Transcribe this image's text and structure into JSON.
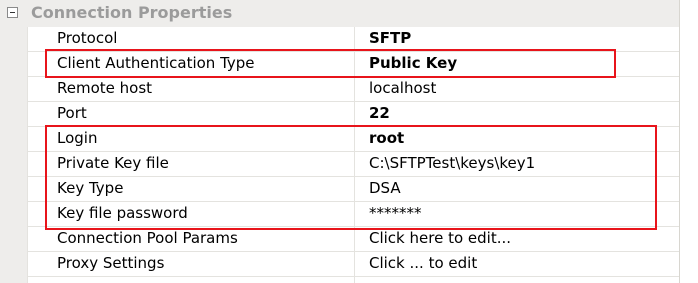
{
  "category": {
    "label": "Connection Properties"
  },
  "properties": [
    {
      "name": "Protocol",
      "value": "SFTP",
      "bold": true
    },
    {
      "name": "Client Authentication Type",
      "value": "Public Key",
      "bold": true
    },
    {
      "name": "Remote host",
      "value": "localhost",
      "bold": false
    },
    {
      "name": "Port",
      "value": "22",
      "bold": true
    },
    {
      "name": "Login",
      "value": "root",
      "bold": true
    },
    {
      "name": "Private Key file",
      "value": "C:\\SFTPTest\\keys\\key1",
      "bold": false
    },
    {
      "name": "Key Type",
      "value": "DSA",
      "bold": false
    },
    {
      "name": "Key file password",
      "value": "*******",
      "bold": false
    },
    {
      "name": "Connection Pool Params",
      "value": "Click here to edit...",
      "bold": false
    },
    {
      "name": "Proxy Settings",
      "value": "Click ... to edit",
      "bold": false
    }
  ],
  "colors": {
    "highlight": "#e8141b",
    "category_bg": "#eeedeb",
    "category_text": "#9b9b9b"
  }
}
